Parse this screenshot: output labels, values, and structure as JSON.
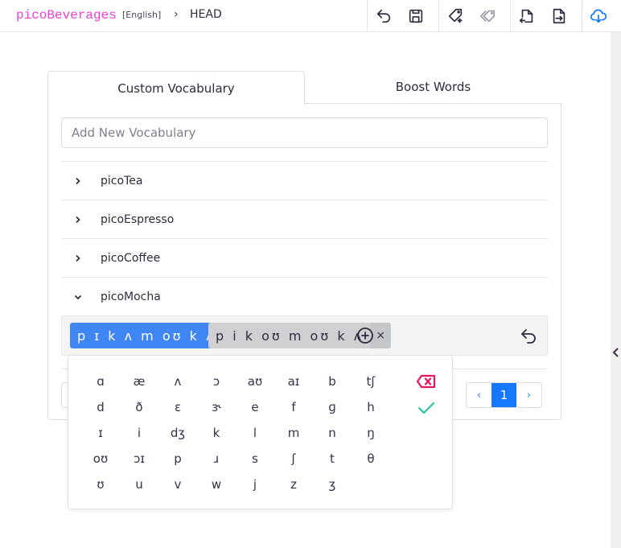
{
  "header": {
    "project_name": "picoBeverages",
    "language": "[English]",
    "breadcrumb_separator": "›",
    "branch": "HEAD",
    "toolbar": [
      {
        "icon": "undo-icon",
        "label": "Undo"
      },
      {
        "icon": "save-icon",
        "label": "Save"
      },
      {
        "icon": "tag-add-icon",
        "label": "Add tag"
      },
      {
        "icon": "tags-icon",
        "label": "Tags",
        "disabled": true
      },
      {
        "icon": "file-import-icon",
        "label": "Import"
      },
      {
        "icon": "file-export-icon",
        "label": "Export"
      },
      {
        "icon": "cloud-download-icon",
        "label": "Download"
      }
    ]
  },
  "colors": {
    "brand": "#f03fd6",
    "accent": "#1677ff",
    "chip_blue": "#3f86f4",
    "chip_gray": "#cfd0d1",
    "delete": "#e8175d",
    "confirm": "#2ac7a6"
  },
  "tabs": [
    {
      "label": "Custom Vocabulary",
      "active": true
    },
    {
      "label": "Boost Words",
      "active": false
    }
  ],
  "add_input": {
    "placeholder": "Add New Vocabulary",
    "value": ""
  },
  "vocabulary": [
    {
      "word": "picoTea",
      "expanded": false
    },
    {
      "word": "picoEspresso",
      "expanded": false
    },
    {
      "word": "picoCoffee",
      "expanded": false
    },
    {
      "word": "picoMocha",
      "expanded": true
    }
  ],
  "pronunciations": [
    {
      "ipa": "pɪkʌmoʊkʌ",
      "display": "p ɪ k ʌ m oʊ k ʌ",
      "selected": true,
      "remove": "×"
    },
    {
      "ipa": "pikoʊmoʊkʌ",
      "display": "p i k oʊ m oʊ k ʌ",
      "selected": false,
      "remove": "×"
    }
  ],
  "pagination": {
    "prev": "‹",
    "current": "1",
    "next": "›"
  },
  "ipa_keyboard": {
    "keys": [
      "ɑ",
      "æ",
      "ʌ",
      "ɔ",
      "aʊ",
      "aɪ",
      "b",
      "tʃ",
      "d",
      "ð",
      "ɛ",
      "ɝ",
      "e",
      "f",
      "ɡ",
      "h",
      "ɪ",
      "i",
      "dʒ",
      "k",
      "l",
      "m",
      "n",
      "ŋ",
      "oʊ",
      "ɔɪ",
      "p",
      "ɹ",
      "s",
      "ʃ",
      "t",
      "θ",
      "ʊ",
      "u",
      "v",
      "w",
      "j",
      "z",
      "ʒ"
    ]
  }
}
